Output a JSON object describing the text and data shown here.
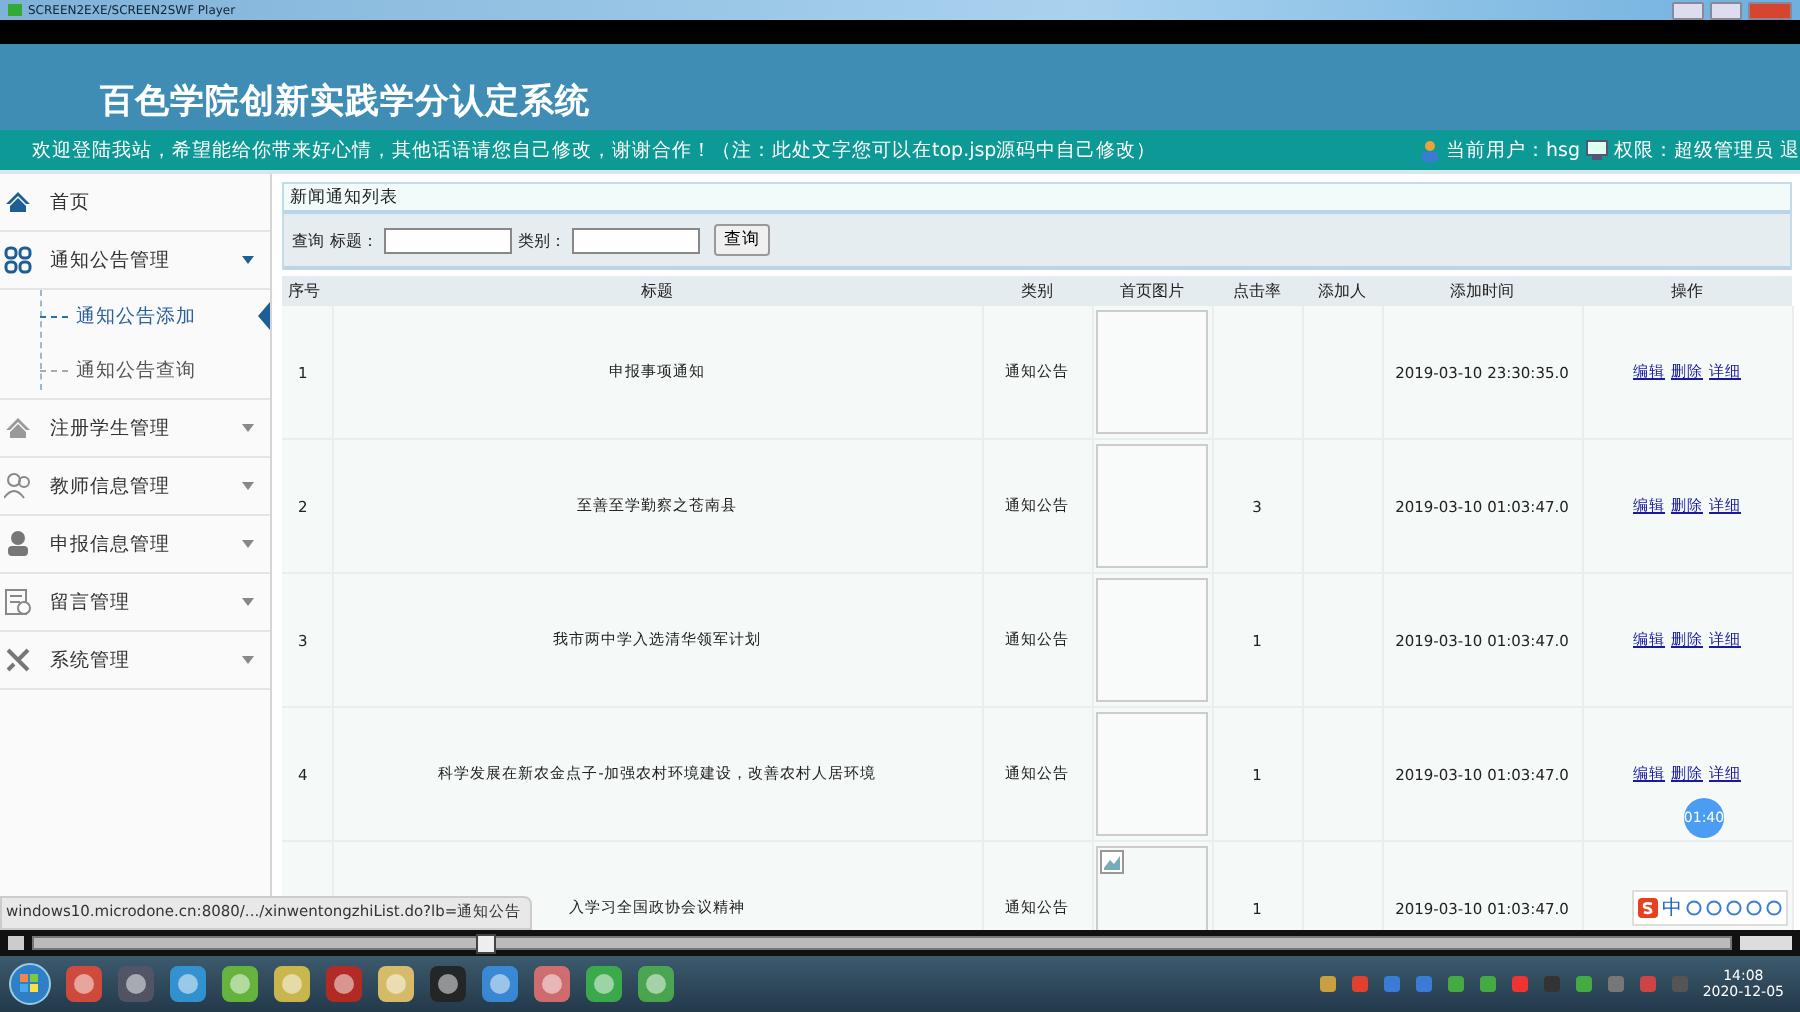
{
  "player_window": {
    "title": "SCREEN2EXE/SCREEN2SWF Player"
  },
  "header": {
    "title": "百色学院创新实践学分认定系统",
    "welcome": "欢迎登陆我站，希望能给你带来好心情，其他话语请您自己修改，谢谢合作！（注：此处文字您可以在top.jsp源码中自己修改）",
    "current_user": "当前用户：hsg",
    "role": "权限：超级管理员",
    "logout": "退"
  },
  "sidebar": {
    "items": [
      {
        "kind": "link",
        "label": "首页"
      },
      {
        "kind": "group",
        "label": "通知公告管理",
        "expanded": true,
        "children": [
          {
            "label": "通知公告添加",
            "selected": true
          },
          {
            "label": "通知公告查询",
            "selected": false
          }
        ]
      },
      {
        "kind": "group",
        "label": "注册学生管理",
        "expanded": false
      },
      {
        "kind": "group",
        "label": "教师信息管理",
        "expanded": false
      },
      {
        "kind": "group",
        "label": "申报信息管理",
        "expanded": false
      },
      {
        "kind": "group",
        "label": "留言管理",
        "expanded": false
      },
      {
        "kind": "group",
        "label": "系统管理",
        "expanded": false
      }
    ]
  },
  "panel": {
    "title": "新闻通知列表"
  },
  "search": {
    "label": "查询",
    "fields": [
      "标题：",
      "类别："
    ],
    "button": "查询"
  },
  "table": {
    "columns": [
      "序号",
      "标题",
      "类别",
      "首页图片",
      "点击率",
      "添加人",
      "添加时间",
      "操作"
    ],
    "rows": [
      {
        "no": "1",
        "title": "申报事项通知",
        "category": "通知公告",
        "image": {
          "kind": "placeholder"
        },
        "clicks": "",
        "adder": "",
        "time": "2019-03-10 23:30:35.0",
        "actions": [
          "编辑",
          "删除",
          "详细"
        ]
      },
      {
        "no": "2",
        "title": "至善至学勤察之苍南县",
        "category": "通知公告",
        "image": {
          "kind": "placeholder"
        },
        "clicks": "3",
        "adder": "",
        "time": "2019-03-10 01:03:47.0",
        "actions": [
          "编辑",
          "删除",
          "详细"
        ]
      },
      {
        "no": "3",
        "title": "我市两中学入选清华领军计划",
        "category": "通知公告",
        "image": {
          "kind": "placeholder"
        },
        "clicks": "1",
        "adder": "",
        "time": "2019-03-10 01:03:47.0",
        "actions": [
          "编辑",
          "删除",
          "详细"
        ]
      },
      {
        "no": "4",
        "title": "科学发展在新农金点子-加强农村环境建设，改善农村人居环境",
        "category": "通知公告",
        "image": {
          "kind": "placeholder"
        },
        "clicks": "1",
        "adder": "",
        "time": "2019-03-10 01:03:47.0",
        "actions": [
          "编辑",
          "删除",
          "详细"
        ]
      },
      {
        "title": "入学习全国政协会议精神",
        "category": "通知公告",
        "image": {
          "kind": "broken"
        },
        "clicks": "1",
        "adder": "",
        "time": "2019-03-10 01:03:47.0"
      }
    ]
  },
  "status_bar": {
    "url": "windows10.microdone.cn:8080/.../xinwentongzhiList.do?lb=通知公告"
  },
  "recording_badge": {
    "time": "01:40"
  },
  "ime": {
    "mode": "中"
  },
  "player": {
    "seek": {
      "level": 0.265
    }
  },
  "taskbar": {
    "time": "14:08",
    "date": "2020-12-05"
  }
}
